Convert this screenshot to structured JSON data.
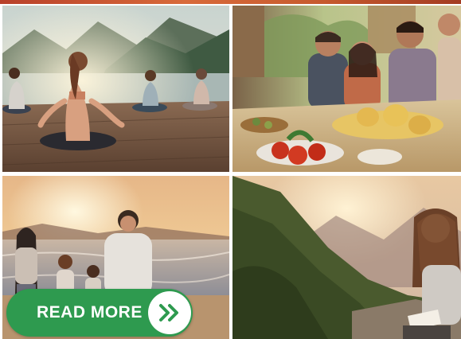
{
  "images": {
    "yoga": {
      "description_icon": "yoga-photo"
    },
    "food": {
      "description_icon": "cooking-photo"
    },
    "beach": {
      "description_icon": "beach-family-photo"
    },
    "mountain": {
      "description_icon": "mountain-reading-photo"
    }
  },
  "cta": {
    "label": "READ MORE",
    "icon": "double-chevron-right-icon",
    "color": "#2e9a4f",
    "icon_color": "#2e9a4f"
  }
}
